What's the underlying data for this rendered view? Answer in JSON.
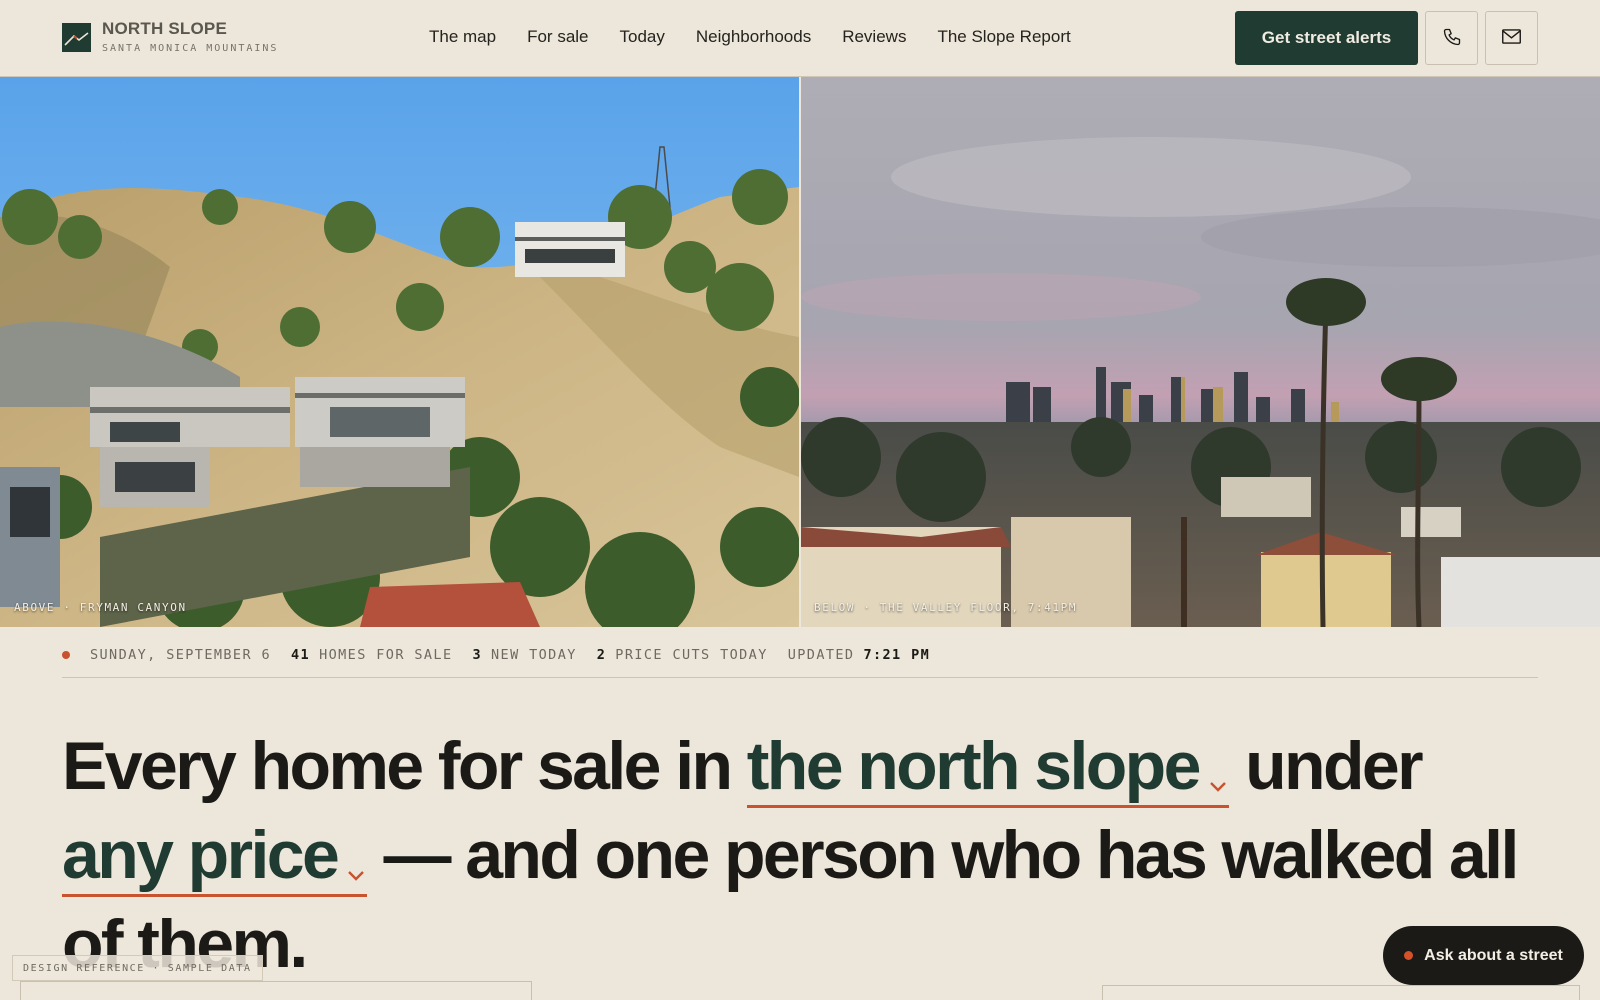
{
  "brand": {
    "name": "NORTH SLOPE",
    "subtitle": "SANTA MONICA MOUNTAINS",
    "logo_icon": "mountain-logo-icon"
  },
  "nav": {
    "items": [
      {
        "label": "The map"
      },
      {
        "label": "For sale"
      },
      {
        "label": "Today"
      },
      {
        "label": "Neighborhoods"
      },
      {
        "label": "Reviews"
      },
      {
        "label": "The Slope Report"
      }
    ]
  },
  "header_actions": {
    "cta_label": "Get street alerts",
    "phone_icon": "phone-icon",
    "mail_icon": "mail-icon"
  },
  "hero": {
    "left_caption": "ABOVE · FRYMAN CANYON",
    "right_caption": "BELOW · THE VALLEY FLOOR, 7:41PM"
  },
  "status": {
    "date": "SUNDAY, SEPTEMBER 6",
    "homes_count": "41",
    "homes_label": "HOMES FOR SALE",
    "new_count": "3",
    "new_label": "NEW TODAY",
    "cuts_count": "2",
    "cuts_label": "PRICE CUTS TODAY",
    "updated_label": "UPDATED",
    "updated_time": "7:21 PM"
  },
  "headline": {
    "part1": "Every home for sale in",
    "area_select": "the north slope",
    "part2": "under",
    "price_select": "any price",
    "part3": "— and one person who has walked all of them."
  },
  "footer": {
    "reference_tag": "DESIGN REFERENCE · SAMPLE DATA",
    "ask_label": "Ask about a street"
  },
  "colors": {
    "background": "#ede6da",
    "brand_green": "#1f3b32",
    "accent_orange": "#c9532f",
    "ink": "#1b1a17"
  }
}
